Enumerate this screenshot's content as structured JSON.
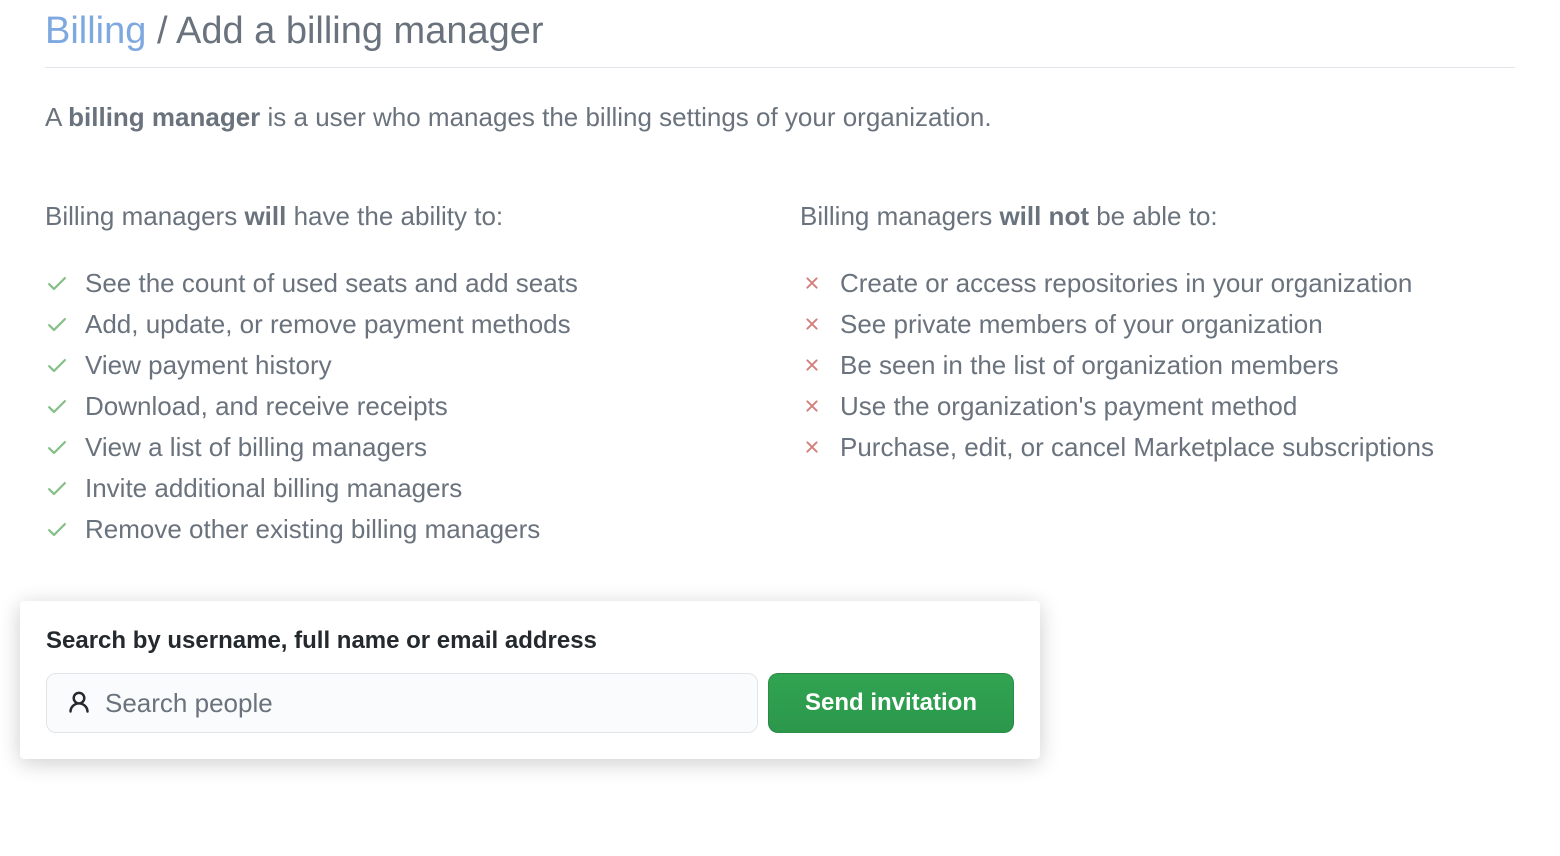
{
  "header": {
    "breadcrumb_link": "Billing",
    "breadcrumb_separator": " / ",
    "page_title": "Add a billing manager"
  },
  "intro": {
    "prefix": "A ",
    "bold": "billing manager",
    "suffix": " is a user who manages the billing settings of your organization."
  },
  "abilities": {
    "will_heading_prefix": "Billing managers ",
    "will_heading_bold": "will",
    "will_heading_suffix": " have the ability to:",
    "will_list": [
      "See the count of used seats and add seats",
      "Add, update, or remove payment methods",
      "View payment history",
      "Download, and receive receipts",
      "View a list of billing managers",
      "Invite additional billing managers",
      "Remove other existing billing managers"
    ],
    "wont_heading_prefix": "Billing managers ",
    "wont_heading_bold": "will not",
    "wont_heading_suffix": " be able to:",
    "wont_list": [
      "Create or access repositories in your organization",
      "See private members of your organization",
      "Be seen in the list of organization members",
      "Use the organization's payment method",
      "Purchase, edit, or cancel Marketplace subscriptions"
    ]
  },
  "search": {
    "label": "Search by username, full name or email address",
    "placeholder": "Search people",
    "button_label": "Send invitation"
  }
}
